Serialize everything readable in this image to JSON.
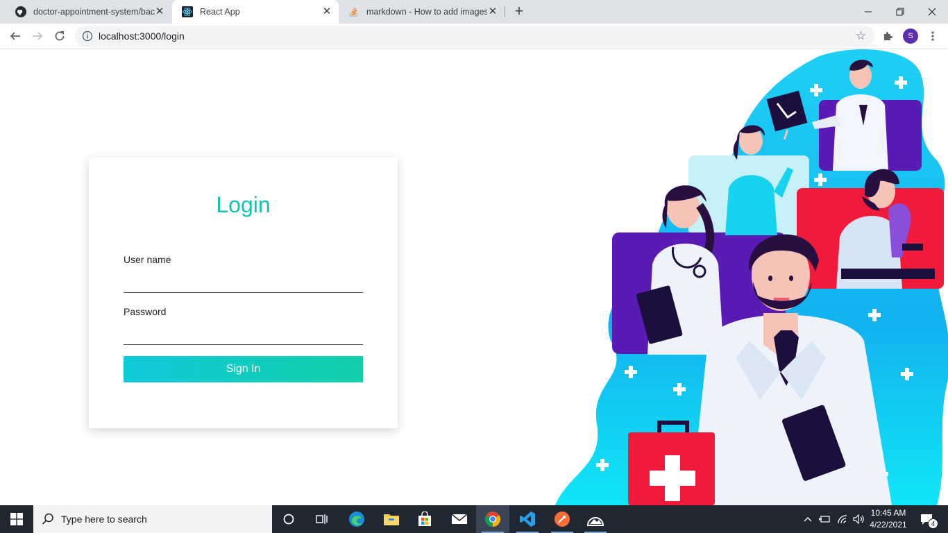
{
  "browser": {
    "tabs": [
      {
        "title": "doctor-appointment-system/bac",
        "icon": "github-icon",
        "active": false
      },
      {
        "title": "React App",
        "icon": "react-icon",
        "active": true
      },
      {
        "title": "markdown - How to add images",
        "icon": "stackoverflow-icon",
        "active": false
      }
    ],
    "url": "localhost:3000/login",
    "profile_initial": "S"
  },
  "login": {
    "title": "Login",
    "username_label": "User name",
    "username_value": "",
    "password_label": "Password",
    "password_value": "",
    "signin_label": "Sign In"
  },
  "colors": {
    "accent": "#14c3b1",
    "button_gradient_start": "#0fc9d8",
    "button_gradient_end": "#10cfa8"
  },
  "taskbar": {
    "search_placeholder": "Type here to search",
    "time": "10:45 AM",
    "date": "4/22/2021",
    "notification_count": "4"
  }
}
